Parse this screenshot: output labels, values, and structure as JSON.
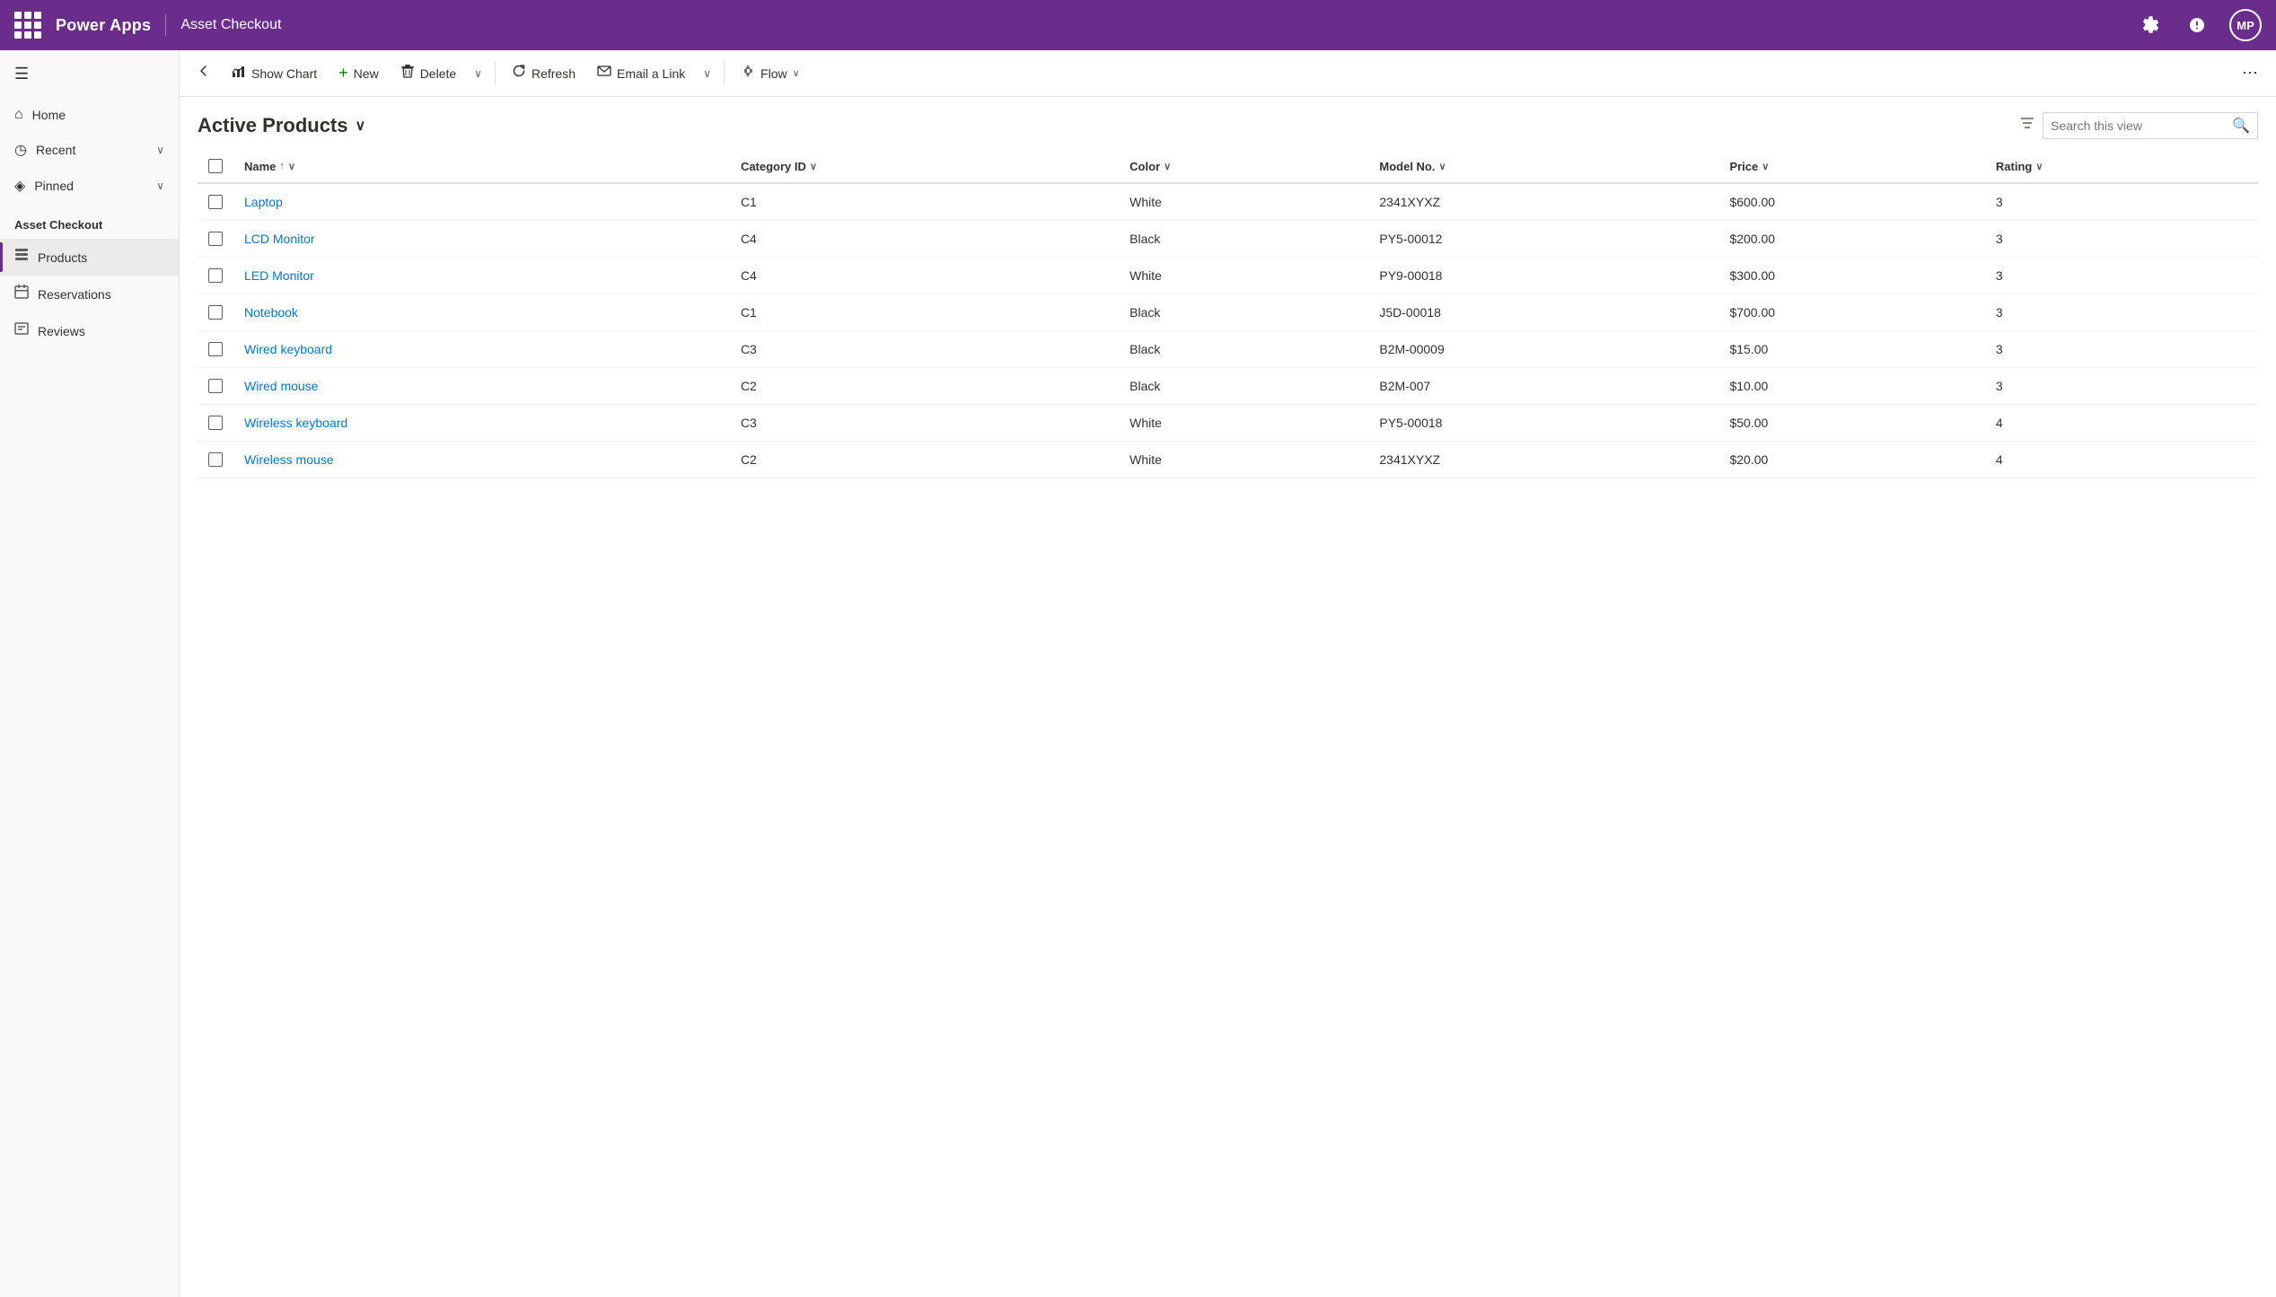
{
  "header": {
    "app_name": "Power Apps",
    "section_name": "Asset Checkout",
    "settings_label": "Settings",
    "help_label": "Help",
    "avatar_initials": "MP"
  },
  "sidebar": {
    "hamburger_label": "☰",
    "nav_items": [
      {
        "id": "home",
        "icon": "⌂",
        "label": "Home",
        "has_chevron": false
      },
      {
        "id": "recent",
        "icon": "◷",
        "label": "Recent",
        "has_chevron": true
      },
      {
        "id": "pinned",
        "icon": "◈",
        "label": "Pinned",
        "has_chevron": true
      }
    ],
    "section_label": "Asset Checkout",
    "app_items": [
      {
        "id": "products",
        "icon": "📋",
        "label": "Products",
        "active": true
      },
      {
        "id": "reservations",
        "icon": "📅",
        "label": "Reservations",
        "active": false
      },
      {
        "id": "reviews",
        "icon": "📝",
        "label": "Reviews",
        "active": false
      }
    ]
  },
  "toolbar": {
    "show_chart_label": "Show Chart",
    "new_label": "New",
    "delete_label": "Delete",
    "refresh_label": "Refresh",
    "email_link_label": "Email a Link",
    "flow_label": "Flow",
    "more_label": "⋯"
  },
  "view": {
    "title": "Active Products",
    "search_placeholder": "Search this view"
  },
  "table": {
    "columns": [
      {
        "id": "name",
        "label": "Name",
        "sortable": true,
        "sort_dir": "asc"
      },
      {
        "id": "category_id",
        "label": "Category ID",
        "sortable": true
      },
      {
        "id": "color",
        "label": "Color",
        "sortable": true
      },
      {
        "id": "model_no",
        "label": "Model No.",
        "sortable": true
      },
      {
        "id": "price",
        "label": "Price",
        "sortable": true
      },
      {
        "id": "rating",
        "label": "Rating",
        "sortable": true
      }
    ],
    "rows": [
      {
        "name": "Laptop",
        "category_id": "C1",
        "color": "White",
        "model_no": "2341XYXZ",
        "price": "$600.00",
        "rating": "3"
      },
      {
        "name": "LCD Monitor",
        "category_id": "C4",
        "color": "Black",
        "model_no": "PY5-00012",
        "price": "$200.00",
        "rating": "3"
      },
      {
        "name": "LED Monitor",
        "category_id": "C4",
        "color": "White",
        "model_no": "PY9-00018",
        "price": "$300.00",
        "rating": "3"
      },
      {
        "name": "Notebook",
        "category_id": "C1",
        "color": "Black",
        "model_no": "J5D-00018",
        "price": "$700.00",
        "rating": "3"
      },
      {
        "name": "Wired keyboard",
        "category_id": "C3",
        "color": "Black",
        "model_no": "B2M-00009",
        "price": "$15.00",
        "rating": "3"
      },
      {
        "name": "Wired mouse",
        "category_id": "C2",
        "color": "Black",
        "model_no": "B2M-007",
        "price": "$10.00",
        "rating": "3"
      },
      {
        "name": "Wireless keyboard",
        "category_id": "C3",
        "color": "White",
        "model_no": "PY5-00018",
        "price": "$50.00",
        "rating": "4"
      },
      {
        "name": "Wireless mouse",
        "category_id": "C2",
        "color": "White",
        "model_no": "2341XYXZ",
        "price": "$20.00",
        "rating": "4"
      }
    ]
  },
  "colors": {
    "brand_purple": "#6b2d8b",
    "link_blue": "#0078d4",
    "border_gray": "#e1dfdd",
    "bg_light": "#faf9f8"
  }
}
